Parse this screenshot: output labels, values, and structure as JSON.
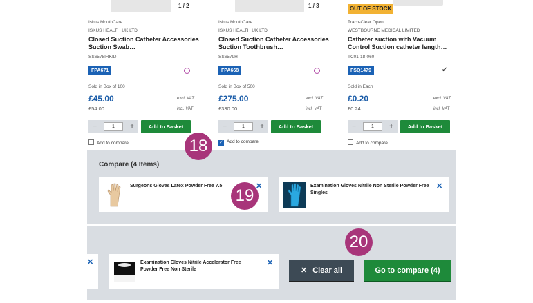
{
  "products": [
    {
      "image_counter": "1 / 2",
      "brand": "Iskus MouthCare",
      "manufacturer": "ISKUS HEALTH UK LTD",
      "name": "Closed Suction Catheter Accessories Suction Swab…",
      "sku": "SS6578IRKID",
      "code": "FPA671",
      "sold_in": "Sold in Box of 100",
      "price": "£45.00",
      "price_inc": "£54.00",
      "excl_vat": "excl. VAT",
      "incl_vat": "incl. VAT",
      "qty": "1",
      "add_to_basket": "Add to Basket",
      "add_to_compare": "Add to compare",
      "compare_checked": false
    },
    {
      "image_counter": "1 / 3",
      "brand": "Iskus MouthCare",
      "manufacturer": "ISKUS HEALTH UK LTD",
      "name": "Closed Suction Catheter Accessories Suction Toothbrush…",
      "sku": "SS6579H",
      "code": "FPA668",
      "sold_in": "Sold in Box of 500",
      "price": "£275.00",
      "price_inc": "£330.00",
      "excl_vat": "excl. VAT",
      "incl_vat": "incl. VAT",
      "qty": "1",
      "add_to_basket": "Add to Basket",
      "add_to_compare": "Add to compare",
      "compare_checked": true
    },
    {
      "stock_badge": "OUT OF STOCK",
      "brand": "Trach-Clear Open",
      "manufacturer": "WESTBOURNE MEDICAL LIMITED",
      "name": "Catheter suction with Vacuum Control Suction catheter length…",
      "sku": "TC01-18-060",
      "code": "FSQ1479",
      "sold_in": "Sold in Each",
      "price": "£0.20",
      "price_inc": "£0.24",
      "excl_vat": "excl. VAT",
      "incl_vat": "incl. VAT",
      "qty": "1",
      "add_to_basket": "Add to Basket",
      "add_to_compare": "Add to compare",
      "compare_checked": false
    }
  ],
  "compare_panel": {
    "title": "Compare (4 Items)",
    "items": [
      {
        "name": "Surgeons Gloves Latex Powder Free 7.5"
      },
      {
        "name": "Examination Gloves Nitrile Non Sterile Powder Free Singles"
      }
    ]
  },
  "compare_bar": {
    "item": {
      "name": "Examination Gloves Nitrile Accelerator Free Powder Free Non Sterile"
    },
    "clear_all": "Clear all",
    "go_to_compare": "Go to compare (4)"
  },
  "markers": {
    "m18": "18",
    "m19": "19",
    "m20": "20"
  },
  "colors": {
    "accent_blue": "#1b62b5",
    "basket_green": "#1e8a3a",
    "panel_grey": "#d9dde2",
    "marker": "#a8357a",
    "out_of_stock": "#f2b233"
  }
}
